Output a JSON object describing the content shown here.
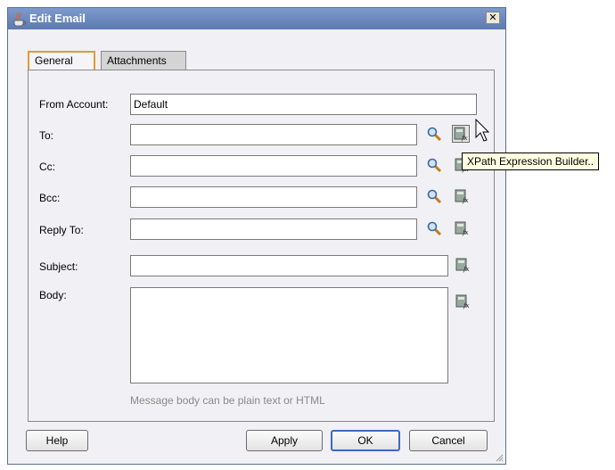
{
  "dialog": {
    "title": "Edit Email",
    "close_label": "✕"
  },
  "tabs": [
    {
      "label": "General",
      "active": true
    },
    {
      "label": "Attachments",
      "active": false
    }
  ],
  "fields": {
    "from_account": {
      "label": "From Account:",
      "value": "Default"
    },
    "to": {
      "label": "To:",
      "value": ""
    },
    "cc": {
      "label": "Cc:",
      "value": ""
    },
    "bcc": {
      "label": "Bcc:",
      "value": ""
    },
    "reply_to": {
      "label": "Reply To:",
      "value": ""
    },
    "subject": {
      "label": "Subject:",
      "value": ""
    },
    "body": {
      "label": "Body:",
      "value": "",
      "hint": "Message body can be plain text or HTML"
    }
  },
  "icons": {
    "search": "search-icon",
    "xpath": "xpath-expression-builder-icon"
  },
  "tooltip": "XPath Expression Builder..",
  "buttons": {
    "help": "Help",
    "apply": "Apply",
    "ok": "OK",
    "cancel": "Cancel"
  },
  "colors": {
    "titlebar": "#5d7ab1",
    "dialog_bg": "#f1f0f4",
    "active_tab_border": "#e29a3a",
    "default_button_border": "#3b6ac2",
    "tooltip_bg": "#ffffe1"
  }
}
